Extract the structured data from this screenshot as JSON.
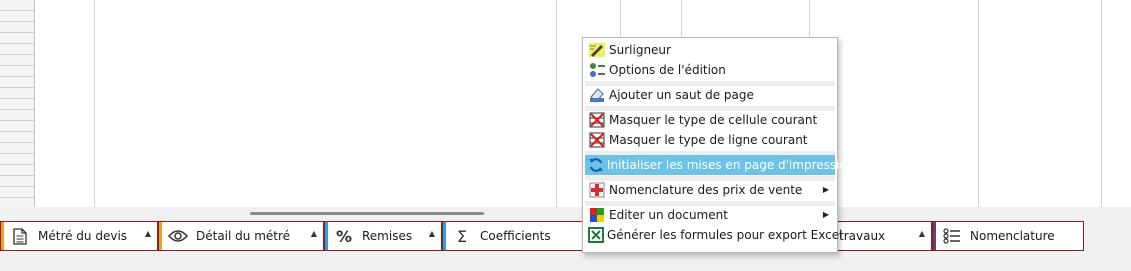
{
  "context_menu": {
    "items": [
      {
        "label": "Surligneur",
        "icon": "highlighter-icon"
      },
      {
        "label": "Options de l'édition",
        "icon": "edit-options-icon"
      },
      {
        "label": "Ajouter un saut de page",
        "icon": "page-break-icon"
      },
      {
        "label": "Masquer le type de cellule courant",
        "icon": "hide-cell-type-icon"
      },
      {
        "label": "Masquer le type de ligne courant",
        "icon": "hide-row-type-icon"
      },
      {
        "label": "Initialiser les mises en page d'impression",
        "icon": "refresh-icon"
      },
      {
        "label": "Nomenclature des prix de vente",
        "icon": "price-nomenclature-icon"
      },
      {
        "label": "Editer un document",
        "icon": "document-icon"
      },
      {
        "label": "Générer les formules pour export Excel",
        "icon": "excel-icon"
      }
    ],
    "highlighted_item": "Initialiser les mises en page d'impression"
  },
  "tabs": [
    {
      "label": "Métré du devis",
      "icon": "document-icon",
      "accent": "#f0a020"
    },
    {
      "label": "Détail du métré",
      "icon": "eye-icon",
      "accent": "#30a0e0"
    },
    {
      "label": "Remises",
      "icon": "percent-icon",
      "accent": "#30a0e0"
    },
    {
      "label": "Coefficients",
      "icon": "sigma-icon",
      "accent": "#30a0e0"
    },
    {
      "label": "travaux",
      "icon": "",
      "accent": "#604080"
    },
    {
      "label": "Nomenclature",
      "icon": "list-icon",
      "accent": "#604080"
    }
  ],
  "colors": {
    "highlight": "#6cc3e6",
    "tab_border": "#8a2020"
  }
}
